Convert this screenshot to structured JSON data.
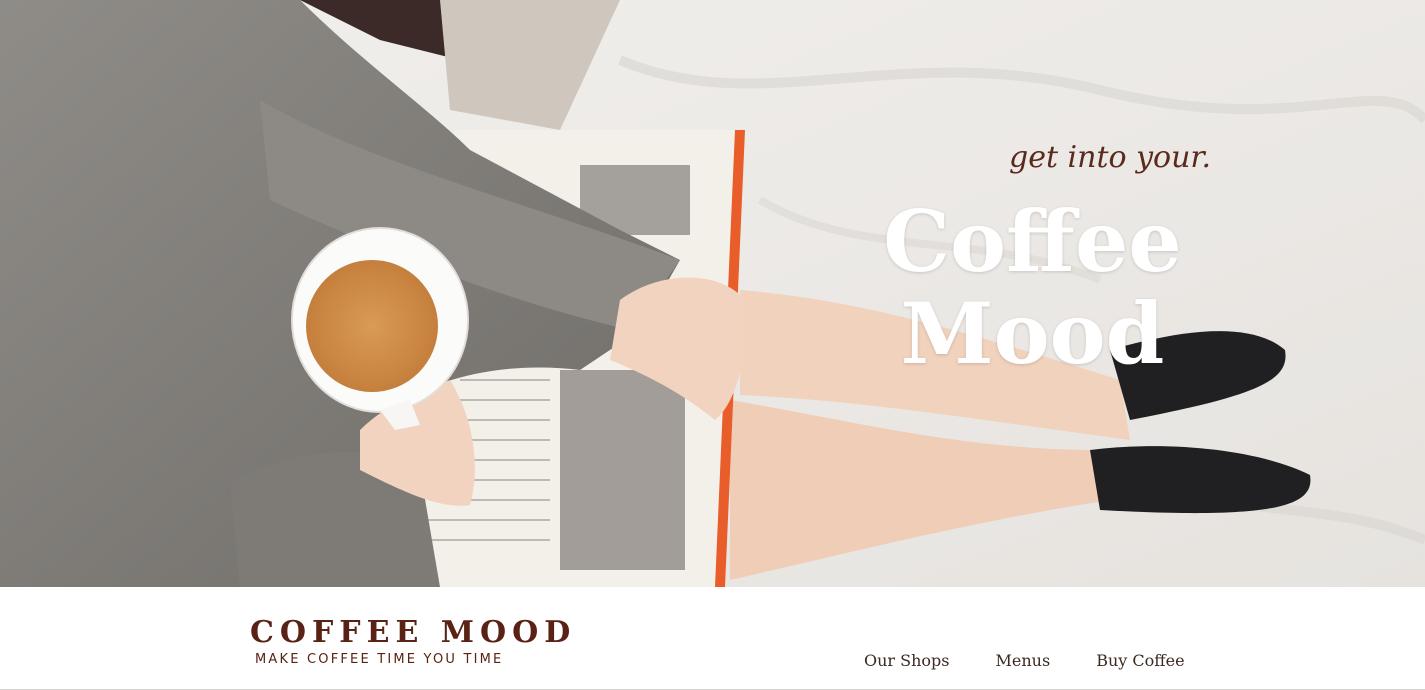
{
  "hero": {
    "kicker": "get into your.",
    "title_line1": "Coffee",
    "title_line2": "Mood"
  },
  "brand": {
    "name": "COFFEE MOOD",
    "tagline": "MAKE COFFEE TIME YOU TIME"
  },
  "nav": {
    "items": [
      {
        "label": "Our Shops"
      },
      {
        "label": "Menus"
      },
      {
        "label": "Buy Coffee"
      }
    ]
  },
  "colors": {
    "brand": "#5a2214",
    "kicker": "#5a2a1c",
    "title": "#ffffff"
  }
}
